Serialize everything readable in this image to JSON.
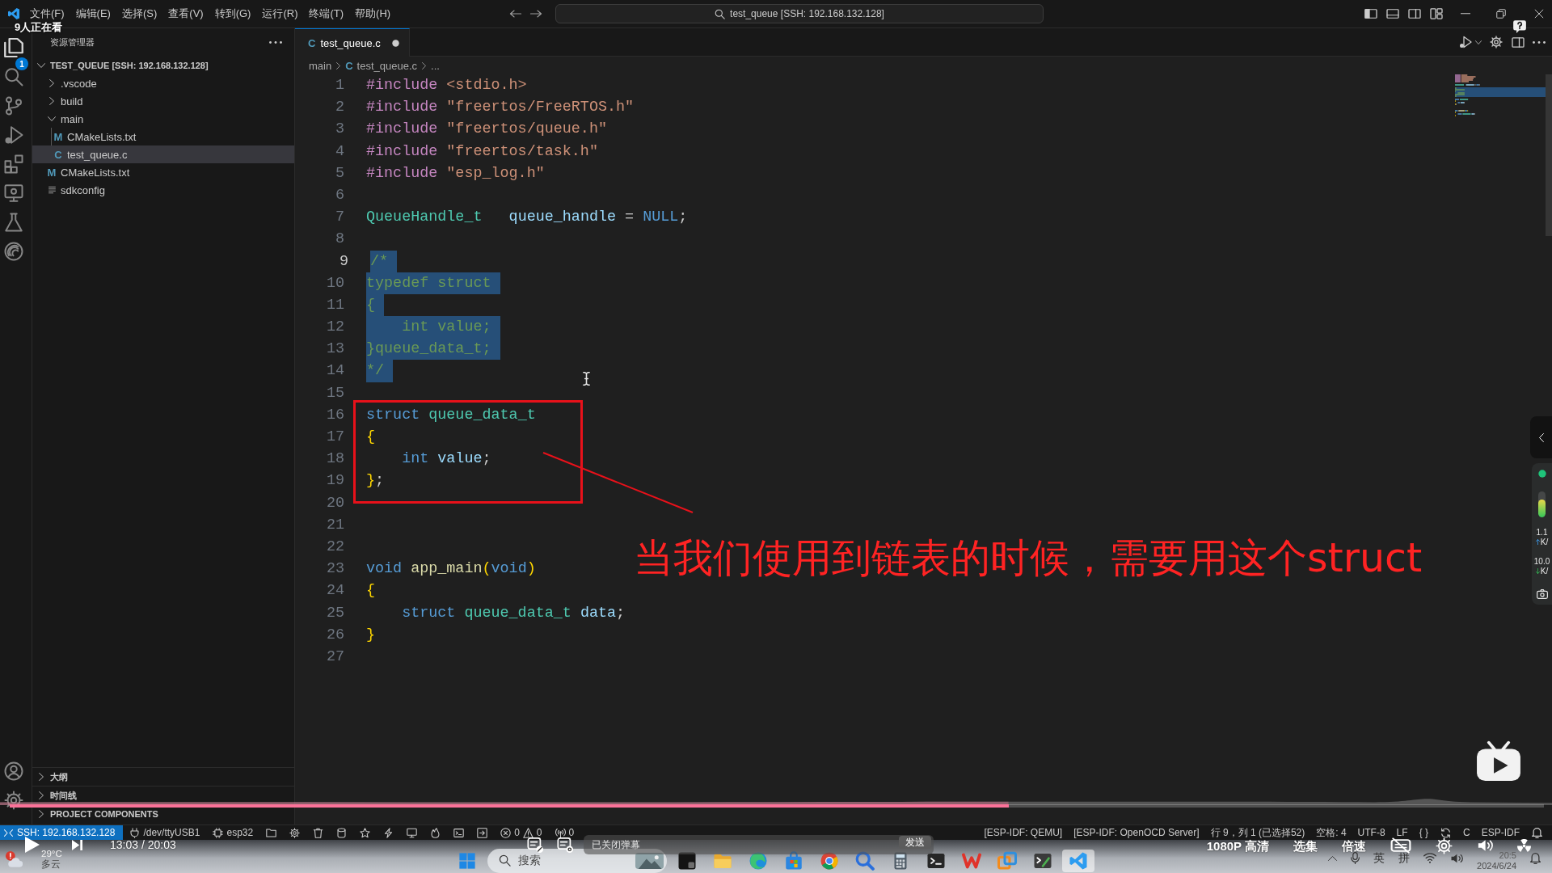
{
  "title_bar": {
    "menus": [
      "文件(F)",
      "编辑(E)",
      "选择(S)",
      "查看(V)",
      "转到(G)",
      "运行(R)",
      "终端(T)",
      "帮助(H)"
    ],
    "command_center": "test_queue [SSH: 192.168.132.128]"
  },
  "viewer_count": "9人正在看",
  "activity_bar": {
    "explorer_badge": "1"
  },
  "sidebar": {
    "title": "资源管理器",
    "root": {
      "label": "TEST_QUEUE [SSH: 192.168.132.128]",
      "expanded": true
    },
    "items": [
      {
        "kind": "folder",
        "label": ".vscode",
        "expanded": false,
        "selected": false
      },
      {
        "kind": "folder",
        "label": "build",
        "expanded": false,
        "selected": false
      },
      {
        "kind": "folder",
        "label": "main",
        "expanded": true,
        "selected": false,
        "children": [
          {
            "kind": "file",
            "icon": "M",
            "label": "CMakeLists.txt",
            "selected": false
          },
          {
            "kind": "file",
            "icon": "C",
            "label": "test_queue.c",
            "selected": true
          }
        ]
      },
      {
        "kind": "file",
        "icon": "M",
        "label": "CMakeLists.txt",
        "selected": false
      },
      {
        "kind": "config",
        "label": "sdkconfig",
        "selected": false
      }
    ],
    "panels": [
      {
        "label": "大纲",
        "expanded": false
      },
      {
        "label": "时间线",
        "expanded": false
      },
      {
        "label": "PROJECT COMPONENTS",
        "expanded": false
      }
    ]
  },
  "editor": {
    "tab": {
      "icon": "C",
      "label": "test_queue.c",
      "modified": true
    },
    "breadcrumb": [
      {
        "label": "main"
      },
      {
        "icon": "C",
        "label": "test_queue.c"
      },
      {
        "label": "..."
      }
    ],
    "lines": [
      {
        "number": "1",
        "selected": false,
        "active": false,
        "tokens": [
          {
            "text": "#include ",
            "kind": "directive"
          },
          {
            "text": "<stdio.h>",
            "kind": "string"
          }
        ]
      },
      {
        "number": "2",
        "selected": false,
        "active": false,
        "tokens": [
          {
            "text": "#include ",
            "kind": "directive"
          },
          {
            "text": "\"freertos/FreeRTOS.h\"",
            "kind": "string"
          }
        ]
      },
      {
        "number": "3",
        "selected": false,
        "active": false,
        "tokens": [
          {
            "text": "#include ",
            "kind": "directive"
          },
          {
            "text": "\"freertos/queue.h\"",
            "kind": "string"
          }
        ]
      },
      {
        "number": "4",
        "selected": false,
        "active": false,
        "tokens": [
          {
            "text": "#include ",
            "kind": "directive"
          },
          {
            "text": "\"freertos/task.h\"",
            "kind": "string"
          }
        ]
      },
      {
        "number": "5",
        "selected": false,
        "active": false,
        "tokens": [
          {
            "text": "#include ",
            "kind": "directive"
          },
          {
            "text": "\"esp_log.h\"",
            "kind": "string"
          }
        ]
      },
      {
        "number": "6",
        "selected": false,
        "active": false
      },
      {
        "number": "7",
        "selected": false,
        "active": false,
        "tokens": [
          {
            "text": "QueueHandle_t   ",
            "kind": "type"
          },
          {
            "text": "queue_handle",
            "kind": "variable"
          },
          {
            "text": " = ",
            "kind": "plain"
          },
          {
            "text": "NULL",
            "kind": "keyword"
          },
          {
            "text": ";",
            "kind": "plain"
          }
        ]
      },
      {
        "number": "8",
        "selected": false,
        "active": false
      },
      {
        "number": "9",
        "selected": true,
        "active": true,
        "tokens": [
          {
            "text": "/*",
            "kind": "comment"
          }
        ]
      },
      {
        "number": "10",
        "selected": true,
        "active": false,
        "tokens": [
          {
            "text": "typedef struct",
            "kind": "comment"
          }
        ]
      },
      {
        "number": "11",
        "selected": true,
        "active": false,
        "tokens": [
          {
            "text": "{",
            "kind": "comment"
          }
        ]
      },
      {
        "number": "12",
        "selected": true,
        "active": false,
        "tokens": [
          {
            "text": "    int value;",
            "kind": "comment"
          }
        ]
      },
      {
        "number": "13",
        "selected": true,
        "active": false,
        "tokens": [
          {
            "text": "}queue_data_t;",
            "kind": "comment"
          }
        ]
      },
      {
        "number": "14",
        "selected": true,
        "active": false,
        "tokens": [
          {
            "text": "*/",
            "kind": "comment"
          }
        ]
      },
      {
        "number": "15",
        "selected": false,
        "active": false
      },
      {
        "number": "16",
        "selected": false,
        "active": false,
        "tokens": [
          {
            "text": "struct ",
            "kind": "keyword"
          },
          {
            "text": "queue_data_t",
            "kind": "type"
          }
        ]
      },
      {
        "number": "17",
        "selected": false,
        "active": false,
        "tokens": [
          {
            "text": "{",
            "kind": "bracket"
          }
        ]
      },
      {
        "number": "18",
        "selected": false,
        "active": false,
        "tokens": [
          {
            "text": "    int ",
            "kind": "keyword"
          },
          {
            "text": "value",
            "kind": "variable"
          },
          {
            "text": ";",
            "kind": "plain"
          }
        ]
      },
      {
        "number": "19",
        "selected": false,
        "active": false,
        "tokens": [
          {
            "text": "}",
            "kind": "bracket"
          },
          {
            "text": ";",
            "kind": "plain"
          }
        ]
      },
      {
        "number": "20",
        "selected": false,
        "active": false
      },
      {
        "number": "21",
        "selected": false,
        "active": false
      },
      {
        "number": "22",
        "selected": false,
        "active": false
      },
      {
        "number": "23",
        "selected": false,
        "active": false,
        "tokens": [
          {
            "text": "void ",
            "kind": "keyword"
          },
          {
            "text": "app_main",
            "kind": "function"
          },
          {
            "text": "(",
            "kind": "bracket"
          },
          {
            "text": "void",
            "kind": "keyword"
          },
          {
            "text": ")",
            "kind": "bracket"
          }
        ]
      },
      {
        "number": "24",
        "selected": false,
        "active": false,
        "tokens": [
          {
            "text": "{",
            "kind": "bracket"
          }
        ]
      },
      {
        "number": "25",
        "selected": false,
        "active": false,
        "tokens": [
          {
            "text": "    struct ",
            "kind": "keyword"
          },
          {
            "text": "queue_data_t ",
            "kind": "type"
          },
          {
            "text": "data",
            "kind": "variable"
          },
          {
            "text": ";",
            "kind": "plain"
          }
        ]
      },
      {
        "number": "26",
        "selected": false,
        "active": false,
        "tokens": [
          {
            "text": "}",
            "kind": "bracket"
          }
        ]
      },
      {
        "number": "27",
        "selected": false,
        "active": false
      }
    ]
  },
  "annotation": {
    "text": "当我们使用到链表的时候，需要用这个struct"
  },
  "status_bar": {
    "remote": "SSH: 192.168.132.128",
    "left": [
      {
        "kind": "plug",
        "label": "/dev/ttyUSB1"
      },
      {
        "kind": "chip",
        "label": "esp32"
      },
      {
        "kind": "folder"
      },
      {
        "kind": "gear"
      },
      {
        "kind": "trash"
      },
      {
        "kind": "database"
      },
      {
        "kind": "star"
      },
      {
        "kind": "bolt"
      },
      {
        "kind": "monitor"
      },
      {
        "kind": "flame"
      },
      {
        "kind": "terminal"
      },
      {
        "kind": "export"
      }
    ],
    "problems": {
      "errors": "0",
      "warnings": "0"
    },
    "ports": "0",
    "right": [
      {
        "kind": "text",
        "label": "[ESP-IDF: QEMU]"
      },
      {
        "kind": "text",
        "label": "[ESP-IDF: OpenOCD Server]"
      },
      {
        "kind": "text",
        "label": "行 9，列 1 (已选择52)"
      },
      {
        "kind": "text",
        "label": "空格: 4"
      },
      {
        "kind": "text",
        "label": "UTF-8"
      },
      {
        "kind": "text",
        "label": "LF"
      },
      {
        "kind": "text",
        "label": "{ }"
      },
      {
        "kind": "sync"
      },
      {
        "kind": "text",
        "label": "C"
      },
      {
        "kind": "text",
        "label": "ESP-IDF"
      },
      {
        "kind": "bell"
      }
    ]
  },
  "player": {
    "time": "13:03 / 20:03",
    "progress": {
      "level": 0.651
    },
    "danmaku": {
      "placeholder": "已关闭弹幕",
      "send": "发送"
    },
    "quality": "1080P 高清",
    "episodes": "选集",
    "speed": "倍速"
  },
  "net_widget": {
    "meter": {
      "level": 0.7
    },
    "upload": {
      "value": "1.1",
      "unit": "K/"
    },
    "download": {
      "value": "10.0",
      "unit": "K/"
    }
  },
  "taskbar": {
    "weather": {
      "temperature": "29°C",
      "condition": "多云"
    },
    "search": {
      "label": "搜索"
    },
    "apps": [
      {
        "kind": "square",
        "selected": false
      },
      {
        "kind": "folder",
        "selected": false
      },
      {
        "kind": "browser",
        "selected": false
      },
      {
        "kind": "store",
        "selected": false
      },
      {
        "kind": "wheel",
        "selected": false
      },
      {
        "kind": "magnifier",
        "selected": false
      },
      {
        "kind": "calculator",
        "selected": false
      },
      {
        "kind": "terminal",
        "selected": false
      },
      {
        "kind": "office",
        "selected": false
      },
      {
        "kind": "squares",
        "selected": false
      },
      {
        "kind": "console",
        "selected": false
      },
      {
        "kind": "editor",
        "selected": true
      }
    ],
    "tray": {
      "ime": [
        "英",
        "拼"
      ],
      "time": "20:5",
      "date": "2024/6/24"
    }
  }
}
